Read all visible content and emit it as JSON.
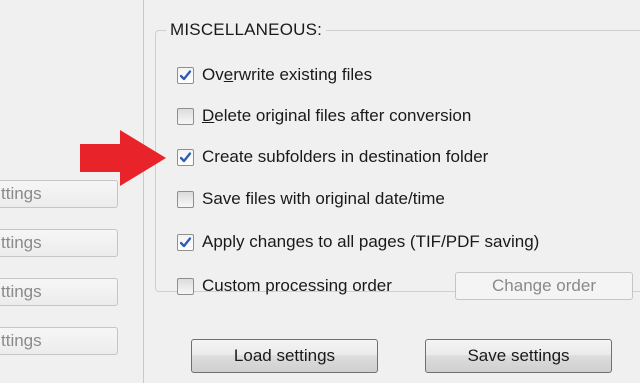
{
  "left_panel": {
    "buttons": [
      "ttings",
      "ttings",
      "ttings",
      "ttings"
    ]
  },
  "misc": {
    "title": "MISCELLANEOUS:",
    "options": [
      {
        "pre": "Ov",
        "ul": "e",
        "post": "rwrite existing files",
        "checked": true
      },
      {
        "pre": "",
        "ul": "D",
        "post": "elete original files after conversion",
        "checked": false
      },
      {
        "pre": "",
        "ul": "",
        "post": "Create subfolders in destination folder",
        "checked": true
      },
      {
        "pre": "",
        "ul": "",
        "post": "Save files with original date/time",
        "checked": false
      },
      {
        "pre": "",
        "ul": "",
        "post": "Apply changes to all pages (TIF/PDF saving)",
        "checked": true
      },
      {
        "pre": "",
        "ul": "",
        "post": "Custom processing order",
        "checked": false
      }
    ],
    "change_order_label": "Change order"
  },
  "footer": {
    "load_label": "Load settings",
    "save_label": "Save settings"
  },
  "colors": {
    "arrow": "#e8232a",
    "checkmark": "#2c5bb5"
  },
  "icons": {
    "annotation_arrow": "red-arrow-right",
    "check": "checkmark"
  }
}
